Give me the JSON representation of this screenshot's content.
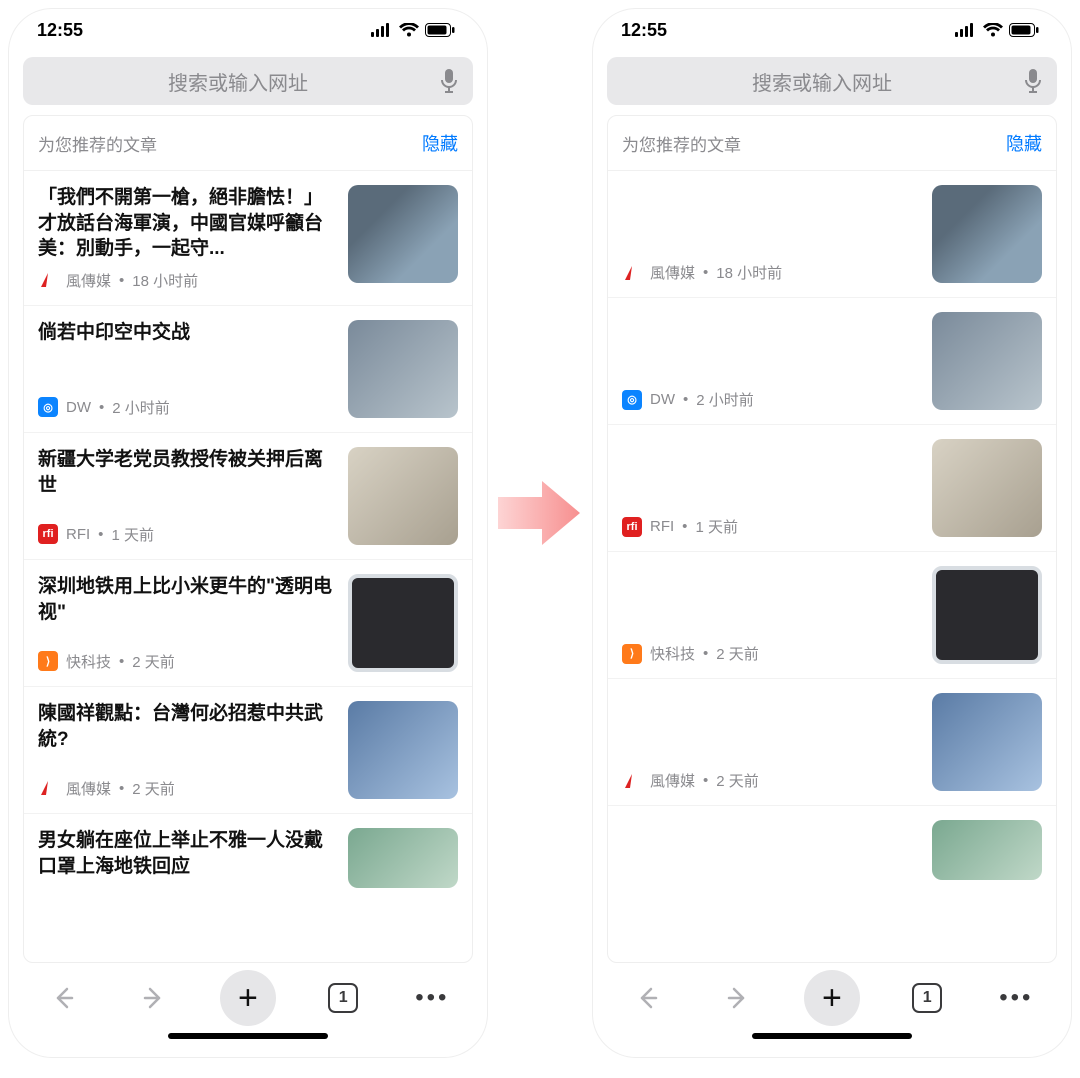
{
  "status": {
    "time": "12:55"
  },
  "search": {
    "placeholder": "搜索或输入网址"
  },
  "section": {
    "title": "为您推荐的文章",
    "hide": "隐藏"
  },
  "articles": [
    {
      "title": "「我們不開第一槍，絕非膽怯！」才放話台海軍演，中國官媒呼籲台美：別動手，一起守...",
      "source": "風傳媒",
      "time": "18 小时前",
      "icon_bg": "#ffffff",
      "icon_accent": "#d22"
    },
    {
      "title": "倘若中印空中交战",
      "source": "DW",
      "time": "2 小时前",
      "icon_bg": "#0b84ff",
      "icon_accent": "#fff"
    },
    {
      "title": "新疆大学老党员教授传被关押后离世",
      "source": "RFI",
      "time": "1 天前",
      "icon_bg": "#e02020",
      "icon_accent": "#fff"
    },
    {
      "title": "深圳地铁用上比小米更牛的\"透明电视\"",
      "source": "快科技",
      "time": "2 天前",
      "icon_bg": "#ff7a1a",
      "icon_accent": "#fff"
    },
    {
      "title": "陳國祥觀點：台灣何必招惹中共武統?",
      "source": "風傳媒",
      "time": "2 天前",
      "icon_bg": "#ffffff",
      "icon_accent": "#d22"
    },
    {
      "title": "男女躺在座位上举止不雅一人没戴口罩上海地铁回应",
      "source": "",
      "time": "",
      "icon_bg": "#ffffff",
      "icon_accent": "#fff"
    }
  ],
  "toolbar": {
    "tab_count": "1"
  }
}
